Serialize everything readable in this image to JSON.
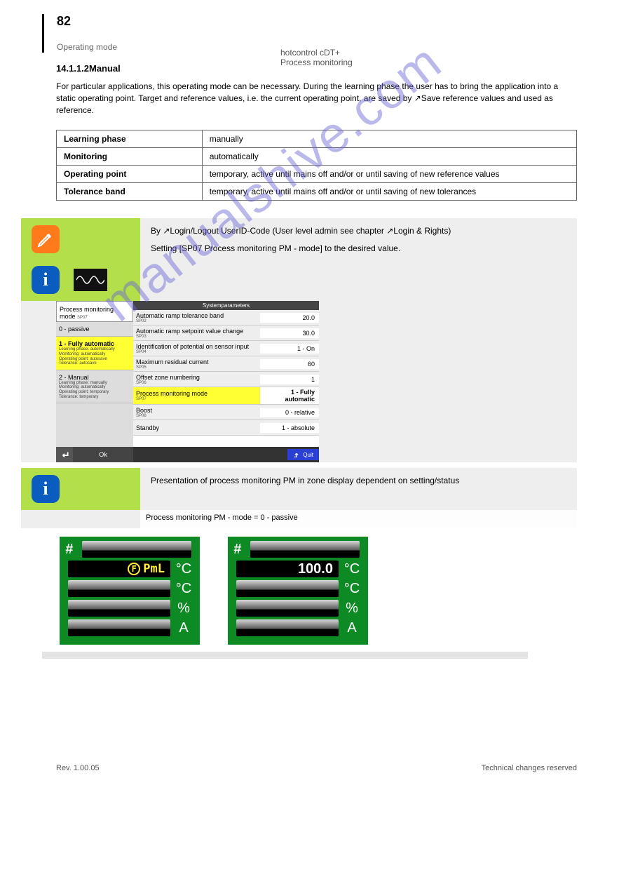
{
  "page": {
    "number": "82",
    "context": "Operating mode",
    "header_title": "hotcontrol cDT+",
    "header_sub": "Process monitoring"
  },
  "section": {
    "subhead": "14.1.1.2Manual",
    "body": "For particular applications, this operating mode can be necessary. During the learning phase the user has to bring the application into a static operating point. Target and reference values, i.e. the current operating point, are saved by ↗Save reference values and used as reference."
  },
  "table": {
    "rows": [
      {
        "k": "Learning phase",
        "v": "manually"
      },
      {
        "k": "Monitoring",
        "v": "automatically"
      },
      {
        "k": "Operating point",
        "v": "temporary, active until mains off and/or or until saving of new reference values"
      },
      {
        "k": "Tolerance band",
        "v": "temporary, active until mains off and/or or until saving of new tolerances"
      }
    ]
  },
  "greenbox": {
    "line1_pre": "By ",
    "line1_link": "↗Login/Logout UserID-Code",
    "line1_post": " (User level admin see chapter ↗Login & Rights)",
    "line2": "Setting [SP07 Process monitoring PM - mode] to the desired value."
  },
  "sysshot": {
    "title": "Systemparameters",
    "left_head": "Process monitoring mode",
    "left_head_sm": "SP07",
    "opt0": {
      "t": "0 - passive"
    },
    "opt1": {
      "t": "1 - Fully automatic",
      "s1": "Learning phase: automatically",
      "s2": "Monitoring: automatically",
      "s3": "Operating point: autosave",
      "s4": "Tolerance: autosave"
    },
    "opt2": {
      "t": "2 - Manual",
      "s1": "Learning phase: manually",
      "s2": "Monitoring: automatically",
      "s3": "Operating point: temporary",
      "s4": "Tolerance: temporary"
    },
    "ok": "Ok",
    "rows": [
      {
        "l": "Automatic ramp tolerance band",
        "sm": "SP02",
        "v": "20.0"
      },
      {
        "l": "Automatic ramp setpoint value change",
        "sm": "SP03",
        "v": "30.0"
      },
      {
        "l": "Identification of potential on sensor input",
        "sm": "SP04",
        "v": "1 - On"
      },
      {
        "l": "Maximum residual current",
        "sm": "SP05",
        "v": "60"
      },
      {
        "l": "Offset zone numbering",
        "sm": "SP06",
        "v": "1"
      },
      {
        "l": "Process monitoring mode",
        "sm": "SP07",
        "v": "1 - Fully automatic",
        "hl": true
      },
      {
        "l": "Boost",
        "sm": "SP08",
        "v": "0 - relative"
      },
      {
        "l": "Standby",
        "sm": "",
        "v": "1 - absolute"
      }
    ],
    "quit": "Quit"
  },
  "info2": {
    "line": "Presentation of process monitoring PM in zone display dependent on setting/status",
    "bar": "Process monitoring PM - mode = 0 - passive"
  },
  "mod": {
    "hash": "#",
    "pml_f": "F",
    "pml": "PmL",
    "val": "100.0",
    "u1": "°C",
    "u2": "°C",
    "u3": "%",
    "u4": "A"
  },
  "footer": {
    "left": "Rev. 1.00.05",
    "right": "Technical changes reserved"
  },
  "watermark": "manualshive.com"
}
